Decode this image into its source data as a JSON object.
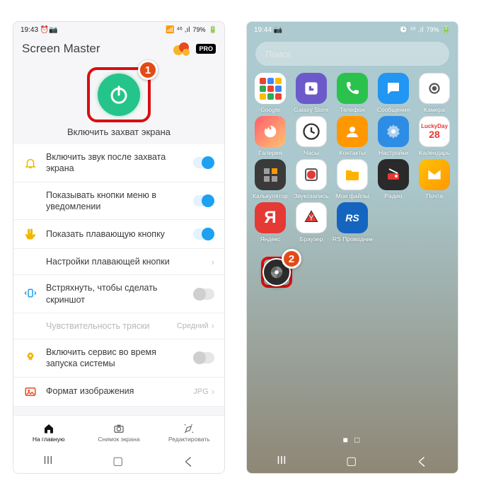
{
  "left": {
    "status": {
      "time": "19:43",
      "indicators": "⏰📷",
      "signal": "📶 ⁴⁶ ,ıl",
      "battery_pct": "79%"
    },
    "app_title": "Screen Master",
    "pro": "PRO",
    "power_caption": "Включить захват экрана",
    "annotation1": "1",
    "settings": [
      {
        "icon": "bell",
        "label": "Включить звук после захвата экрана",
        "toggle": "on"
      },
      {
        "icon": "",
        "label": "Показывать кнопки меню в уведомлении",
        "toggle": "on",
        "indent": true
      },
      {
        "icon": "hand",
        "label": "Показать плавающую кнопку",
        "toggle": "on"
      },
      {
        "icon": "",
        "label": "Настройки плавающей кнопки",
        "right": "",
        "chev": true,
        "indent": true
      },
      {
        "icon": "shake",
        "label": "Встряхнуть, чтобы сделать скриншот",
        "toggle": "off"
      },
      {
        "icon": "",
        "label": "Чувствительность тряски",
        "right": "Средний",
        "chev": true,
        "indent": true,
        "muted": true
      },
      {
        "icon": "rocket",
        "label": "Включить сервис во время запуска системы",
        "toggle": "off"
      },
      {
        "icon": "image",
        "label": "Формат изображения",
        "right": "JPG",
        "chev": true
      }
    ],
    "tabs": [
      {
        "label": "На главную",
        "active": true
      },
      {
        "label": "Снимок экрана",
        "active": false
      },
      {
        "label": "Редактировать",
        "active": false
      }
    ]
  },
  "right": {
    "status": {
      "time": "19:44",
      "indicators": "📷",
      "signal": "🕒 ⁴⁶ ,ıl",
      "battery_pct": "79%"
    },
    "search_placeholder": "Поиск",
    "annotation2": "2",
    "calendar_day": "28",
    "apps": [
      [
        {
          "label": "Google",
          "kind": "google"
        },
        {
          "label": "Galaxy Store",
          "kind": "galaxy"
        },
        {
          "label": "Телефон",
          "kind": "phone"
        },
        {
          "label": "Сообщения",
          "kind": "msg"
        },
        {
          "label": "Камера",
          "kind": "cam"
        }
      ],
      [
        {
          "label": "Галерея",
          "kind": "gallery"
        },
        {
          "label": "Часы",
          "kind": "clock"
        },
        {
          "label": "Контакты",
          "kind": "contacts"
        },
        {
          "label": "Настройки",
          "kind": "settings"
        },
        {
          "label": "Календарь",
          "kind": "calendar"
        }
      ],
      [
        {
          "label": "Калькулятор",
          "kind": "calc"
        },
        {
          "label": "Звукозапись",
          "kind": "rec"
        },
        {
          "label": "Мои файлы",
          "kind": "files"
        },
        {
          "label": "Радио",
          "kind": "radio"
        },
        {
          "label": "Почта",
          "kind": "mail"
        }
      ],
      [
        {
          "label": "Яндекс",
          "kind": "yandex"
        },
        {
          "label": "Браузер",
          "kind": "browser"
        },
        {
          "label": "RS Проводник",
          "kind": "rs"
        },
        {
          "label": "",
          "kind": ""
        },
        {
          "label": "",
          "kind": ""
        }
      ]
    ]
  }
}
